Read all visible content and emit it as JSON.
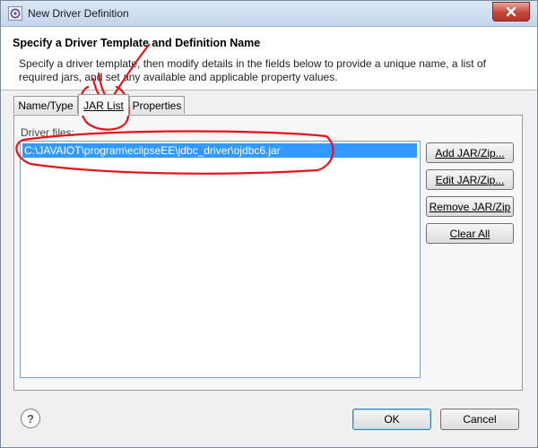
{
  "window": {
    "title": "New Driver Definition"
  },
  "header": {
    "title": "Specify a Driver Template and Definition Name",
    "description": "Specify a driver template, then modify details in the fields below to provide a unique name, a list of required jars, and set any available and applicable property values."
  },
  "tabs": [
    {
      "label": "Name/Type"
    },
    {
      "label": "JAR List"
    },
    {
      "label": "Properties"
    }
  ],
  "jar_list": {
    "label": "Driver files:",
    "items": [
      "C:\\JAVAIOT\\program\\eclipseEE\\jdbc_driver\\ojdbc6.jar"
    ]
  },
  "buttons": {
    "add": "Add JAR/Zip...",
    "edit": "Edit JAR/Zip...",
    "remove": "Remove JAR/Zip",
    "clear": "Clear All"
  },
  "footer": {
    "help": "?",
    "ok": "OK",
    "cancel": "Cancel"
  },
  "colors": {
    "selection": "#3399ff",
    "annotation": "#e8121a"
  }
}
